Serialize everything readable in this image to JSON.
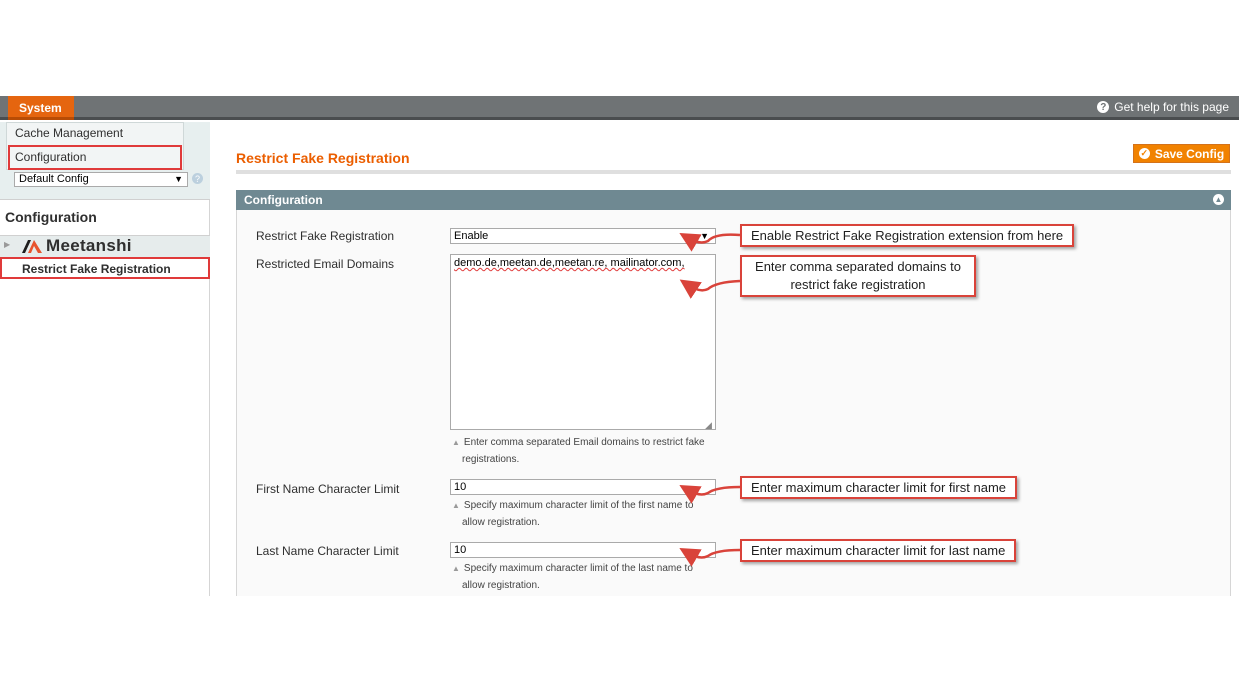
{
  "topbar": {
    "menu_label": "System",
    "help_label": "Get help for this page"
  },
  "menu": {
    "items": [
      "Cache Management",
      "Configuration"
    ]
  },
  "scope": {
    "value": "Default Config"
  },
  "sidebar": {
    "heading": "Configuration",
    "brand": "Meetanshi",
    "active_item": "Restrict Fake Registration"
  },
  "page": {
    "title": "Restrict Fake Registration",
    "save_label": "Save Config"
  },
  "section": {
    "title": "Configuration",
    "fields": [
      {
        "label": "Restrict Fake Registration",
        "value": "Enable"
      },
      {
        "label": "Restricted Email Domains",
        "value": "demo.de,meetan.de,meetan.re, mailinator.com,",
        "note_line1": "Enter comma separated Email domains to restrict fake",
        "note_line2": "registrations."
      },
      {
        "label": "First Name Character Limit",
        "value": "10",
        "note_line1": "Specify maximum character limit of the first name to",
        "note_line2": "allow registration."
      },
      {
        "label": "Last Name Character Limit",
        "value": "10",
        "note_line1": "Specify maximum character limit of the last name to",
        "note_line2": "allow registration."
      }
    ]
  },
  "callouts": {
    "enable": "Enable Restrict Fake Registration extension from here",
    "domains_line1": "Enter comma separated domains to",
    "domains_line2": "restrict fake registration",
    "first_name": "Enter maximum character limit for first name",
    "last_name": "Enter maximum character limit for last name"
  },
  "colors": {
    "accent": "#eb5e00",
    "callout_border": "#d9433a",
    "section_header": "#6f8992"
  }
}
